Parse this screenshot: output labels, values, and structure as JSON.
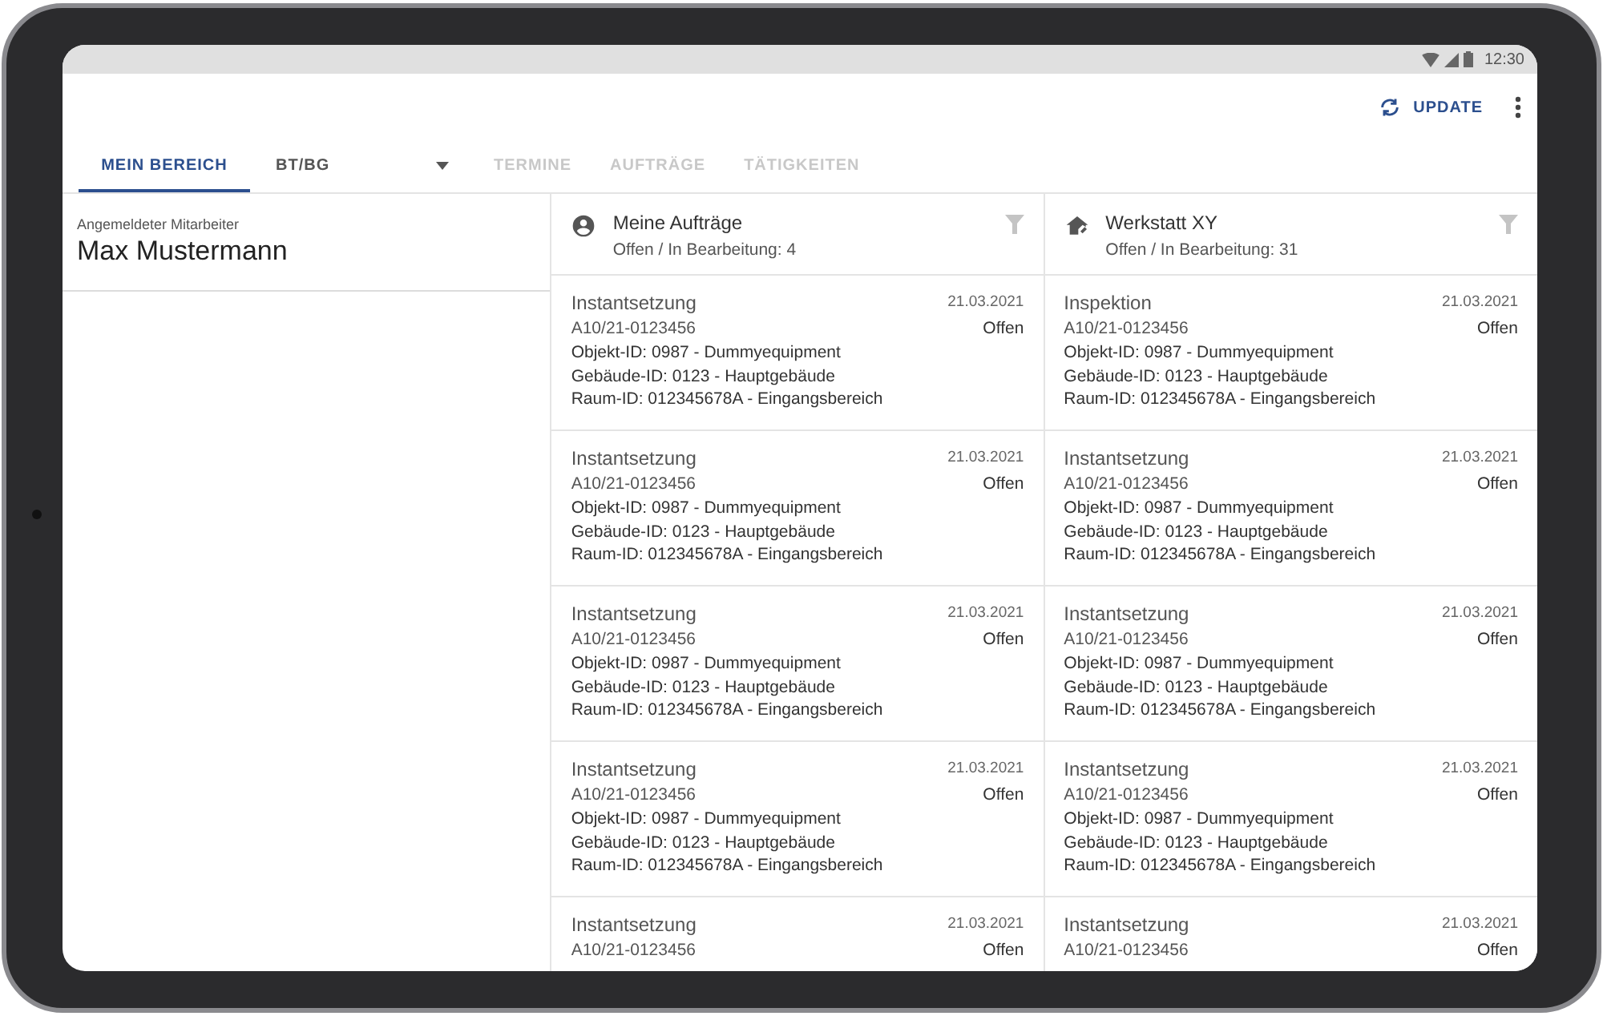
{
  "status_bar": {
    "time": "12:30"
  },
  "app_bar": {
    "update_label": "UPDATE"
  },
  "tabs": [
    {
      "label": "MEIN BEREICH",
      "kind": "tab",
      "selected": true,
      "disabled": false
    },
    {
      "label": "BT/BG",
      "kind": "dropdown",
      "selected": false,
      "disabled": false
    },
    {
      "label": "TERMINE",
      "kind": "tab",
      "selected": false,
      "disabled": true
    },
    {
      "label": "AUFTRÄGE",
      "kind": "tab",
      "selected": false,
      "disabled": true
    },
    {
      "label": "TÄTIGKEITEN",
      "kind": "tab",
      "selected": false,
      "disabled": true
    }
  ],
  "employee": {
    "caption": "Angemeldeter Mitarbeiter",
    "name": "Max Mustermann"
  },
  "columns": [
    {
      "kind": "person",
      "title": "Meine Aufträge",
      "subtitle": "Offen / In Bearbeitung: 4",
      "cards": [
        {
          "title": "Instantsetzung",
          "number": "A10/21-0123456",
          "date": "21.03.2021",
          "status": "Offen",
          "lines": [
            "Objekt-ID: 0987 - Dummyequipment",
            "Gebäude-ID: 0123 - Hauptgebäude",
            "Raum-ID: 012345678A - Eingangsbereich"
          ]
        },
        {
          "title": "Instantsetzung",
          "number": "A10/21-0123456",
          "date": "21.03.2021",
          "status": "Offen",
          "lines": [
            "Objekt-ID: 0987 - Dummyequipment",
            "Gebäude-ID: 0123 - Hauptgebäude",
            "Raum-ID: 012345678A - Eingangsbereich"
          ]
        },
        {
          "title": "Instantsetzung",
          "number": "A10/21-0123456",
          "date": "21.03.2021",
          "status": "Offen",
          "lines": [
            "Objekt-ID: 0987 - Dummyequipment",
            "Gebäude-ID: 0123 - Hauptgebäude",
            "Raum-ID: 012345678A - Eingangsbereich"
          ]
        },
        {
          "title": "Instantsetzung",
          "number": "A10/21-0123456",
          "date": "21.03.2021",
          "status": "Offen",
          "lines": [
            "Objekt-ID: 0987 - Dummyequipment",
            "Gebäude-ID: 0123 - Hauptgebäude",
            "Raum-ID: 012345678A - Eingangsbereich"
          ]
        },
        {
          "title": "Instantsetzung",
          "number": "A10/21-0123456",
          "date": "21.03.2021",
          "status": "Offen"
        }
      ]
    },
    {
      "kind": "workshop",
      "title": "Werkstatt XY",
      "subtitle": "Offen / In Bearbeitung: 31",
      "cards": [
        {
          "title": "Inspektion",
          "number": "A10/21-0123456",
          "date": "21.03.2021",
          "status": "Offen",
          "lines": [
            "Objekt-ID: 0987 - Dummyequipment",
            "Gebäude-ID: 0123 - Hauptgebäude",
            "Raum-ID: 012345678A - Eingangsbereich"
          ]
        },
        {
          "title": "Instantsetzung",
          "number": "A10/21-0123456",
          "date": "21.03.2021",
          "status": "Offen",
          "lines": [
            "Objekt-ID: 0987 - Dummyequipment",
            "Gebäude-ID: 0123 - Hauptgebäude",
            "Raum-ID: 012345678A - Eingangsbereich"
          ]
        },
        {
          "title": "Instantsetzung",
          "number": "A10/21-0123456",
          "date": "21.03.2021",
          "status": "Offen",
          "lines": [
            "Objekt-ID: 0987 - Dummyequipment",
            "Gebäude-ID: 0123 - Hauptgebäude",
            "Raum-ID: 012345678A - Eingangsbereich"
          ]
        },
        {
          "title": "Instantsetzung",
          "number": "A10/21-0123456",
          "date": "21.03.2021",
          "status": "Offen",
          "lines": [
            "Objekt-ID: 0987 - Dummyequipment",
            "Gebäude-ID: 0123 - Hauptgebäude",
            "Raum-ID: 012345678A - Eingangsbereich"
          ]
        },
        {
          "title": "Instantsetzung",
          "number": "A10/21-0123456",
          "date": "21.03.2021",
          "status": "Offen"
        }
      ]
    }
  ]
}
